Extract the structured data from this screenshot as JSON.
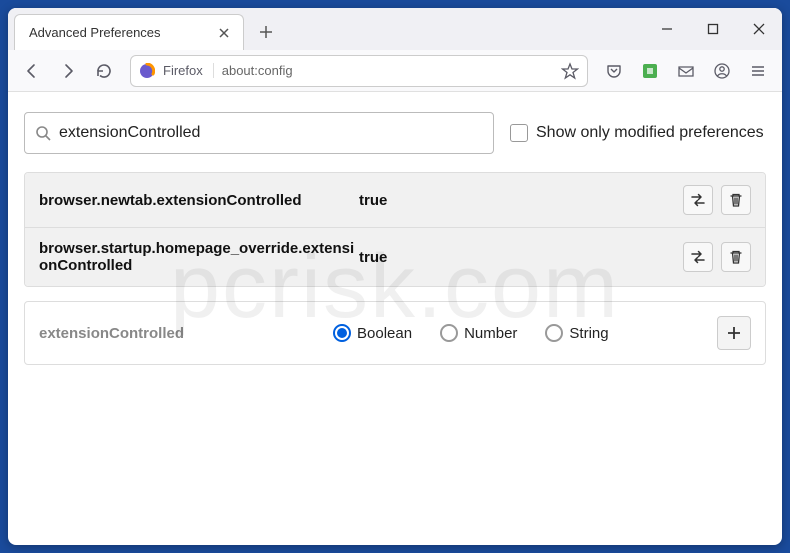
{
  "tab": {
    "title": "Advanced Preferences"
  },
  "urlbar": {
    "brand": "Firefox",
    "url": "about:config"
  },
  "search": {
    "value": "extensionControlled",
    "checkbox_label": "Show only modified preferences"
  },
  "prefs": [
    {
      "name": "browser.newtab.extensionControlled",
      "value": "true"
    },
    {
      "name": "browser.startup.homepage_override.extensionControlled",
      "value": "true"
    }
  ],
  "add": {
    "name": "extensionControlled",
    "types": [
      "Boolean",
      "Number",
      "String"
    ],
    "selected": 0
  },
  "watermark": "pcrisk.com"
}
